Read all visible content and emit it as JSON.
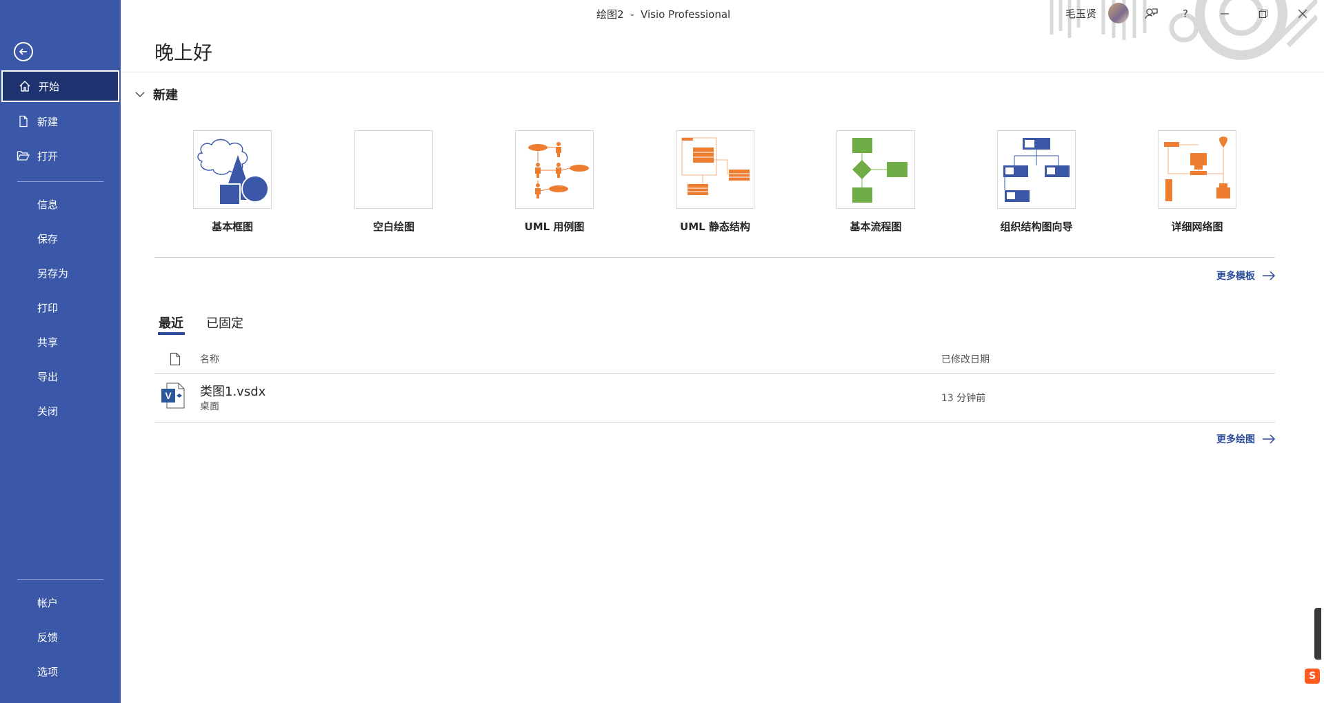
{
  "window": {
    "title": "绘图2  -  Visio Professional",
    "user_name": "毛玉贤",
    "buttons": {
      "minimize": "minimize",
      "restore": "restore",
      "close": "close"
    }
  },
  "sidebar": {
    "primary": [
      {
        "label": "开始",
        "icon": "home-icon",
        "active": true
      },
      {
        "label": "新建",
        "icon": "new-file-icon"
      },
      {
        "label": "打开",
        "icon": "open-folder-icon"
      }
    ],
    "secondary": [
      {
        "label": "信息"
      },
      {
        "label": "保存"
      },
      {
        "label": "另存为"
      },
      {
        "label": "打印"
      },
      {
        "label": "共享"
      },
      {
        "label": "导出"
      },
      {
        "label": "关闭"
      }
    ],
    "bottom": [
      {
        "label": "帐户"
      },
      {
        "label": "反馈"
      },
      {
        "label": "选项"
      }
    ]
  },
  "main": {
    "greeting": "晚上好",
    "new_section_label": "新建",
    "templates": [
      {
        "label": "基本框图"
      },
      {
        "label": "空白绘图"
      },
      {
        "label": "UML 用例图"
      },
      {
        "label": "UML 静态结构"
      },
      {
        "label": "基本流程图"
      },
      {
        "label": "组织结构图向导"
      },
      {
        "label": "详细网络图"
      }
    ],
    "more_templates": "更多模板",
    "tabs": [
      {
        "label": "最近",
        "active": true
      },
      {
        "label": "已固定",
        "active": false
      }
    ],
    "table": {
      "col_name": "名称",
      "col_date": "已修改日期",
      "rows": [
        {
          "name": "类图1.vsdx",
          "location": "桌面",
          "modified": "13 分钟前"
        }
      ]
    },
    "more_drawings": "更多绘图"
  },
  "colors": {
    "sidebar_bg": "#3a57a8",
    "sidebar_active": "#1f3370",
    "accent": "#2b4c9a",
    "orange": "#ed7d31",
    "green": "#70ad47"
  }
}
